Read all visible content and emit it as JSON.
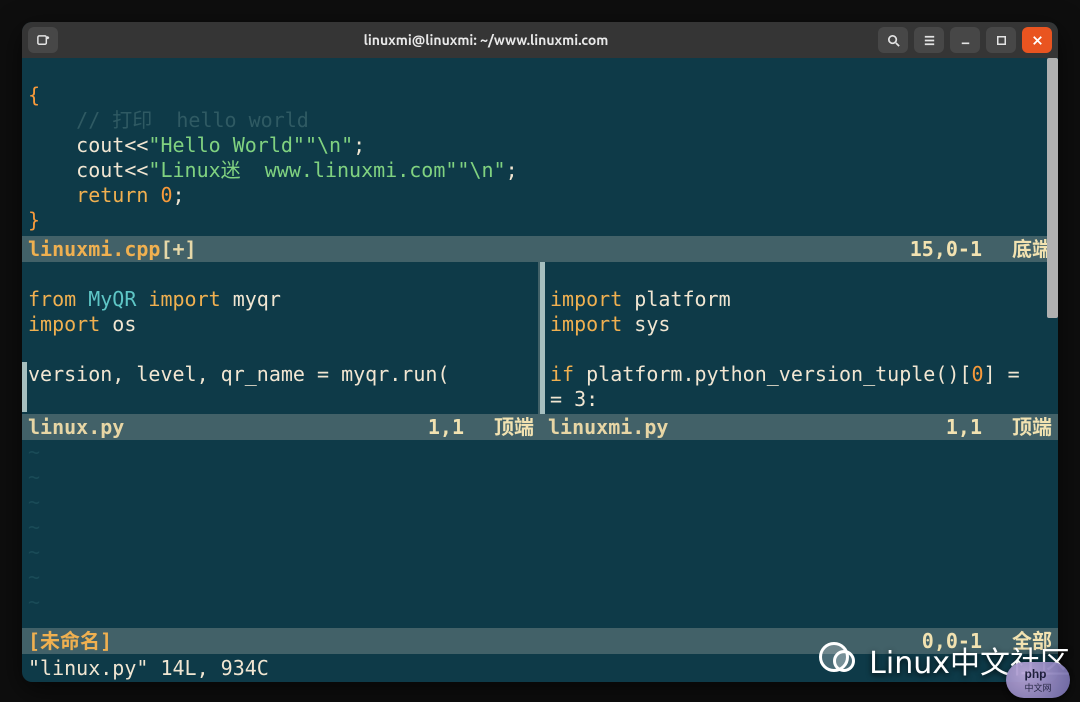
{
  "titlebar": {
    "title": "linuxmi@linuxmi: ~/www.linuxmi.com"
  },
  "top_pane": {
    "brace_open": "{",
    "comment": "// 打印  hello world",
    "line1_pre": "    cout<<",
    "line1_str": "\"Hello World\"",
    "line1_nl": "\"\\n\"",
    "line2_pre": "    cout<<",
    "line2_str": "\"Linux迷  www.linuxmi.com\"",
    "line2_nl": "\"\\n\"",
    "semi": ";",
    "return_kw": "return",
    "return_val": " 0",
    "brace_close": "}",
    "status_file": "linuxmi.cpp",
    "status_mod": " [+]",
    "status_pos": "15,0-1",
    "status_label": "底端"
  },
  "left_pane": {
    "l1_from": "from",
    "l1_mod": " MyQR ",
    "l1_import": "import",
    "l1_name": " myqr",
    "l2_import": "import",
    "l2_name": " os",
    "l3_blank": "",
    "l4": "version, level, qr_name = myqr.run(",
    "status_file": "linux.py",
    "status_pos": "1,1",
    "status_label": "顶端"
  },
  "right_pane": {
    "l1_import": "import",
    "l1_name": " platform",
    "l2_import": "import",
    "l2_name": " sys",
    "l3_blank": "",
    "l4_if": "if",
    "l4_body": " platform.python_version_tuple()[",
    "l4_idx": "0",
    "l4_close": "] =",
    "l5": "= 3:",
    "status_file": "linuxmi.py",
    "status_pos": "1,1",
    "status_label": "顶端"
  },
  "bottom_pane": {
    "status_file": "[未命名]",
    "status_pos": "0,0-1",
    "status_label": "全部"
  },
  "cmdline": "\"linux.py\" 14L, 934C",
  "watermark": "Linux中文社区",
  "php_label": "php",
  "php_sub": "中文网"
}
